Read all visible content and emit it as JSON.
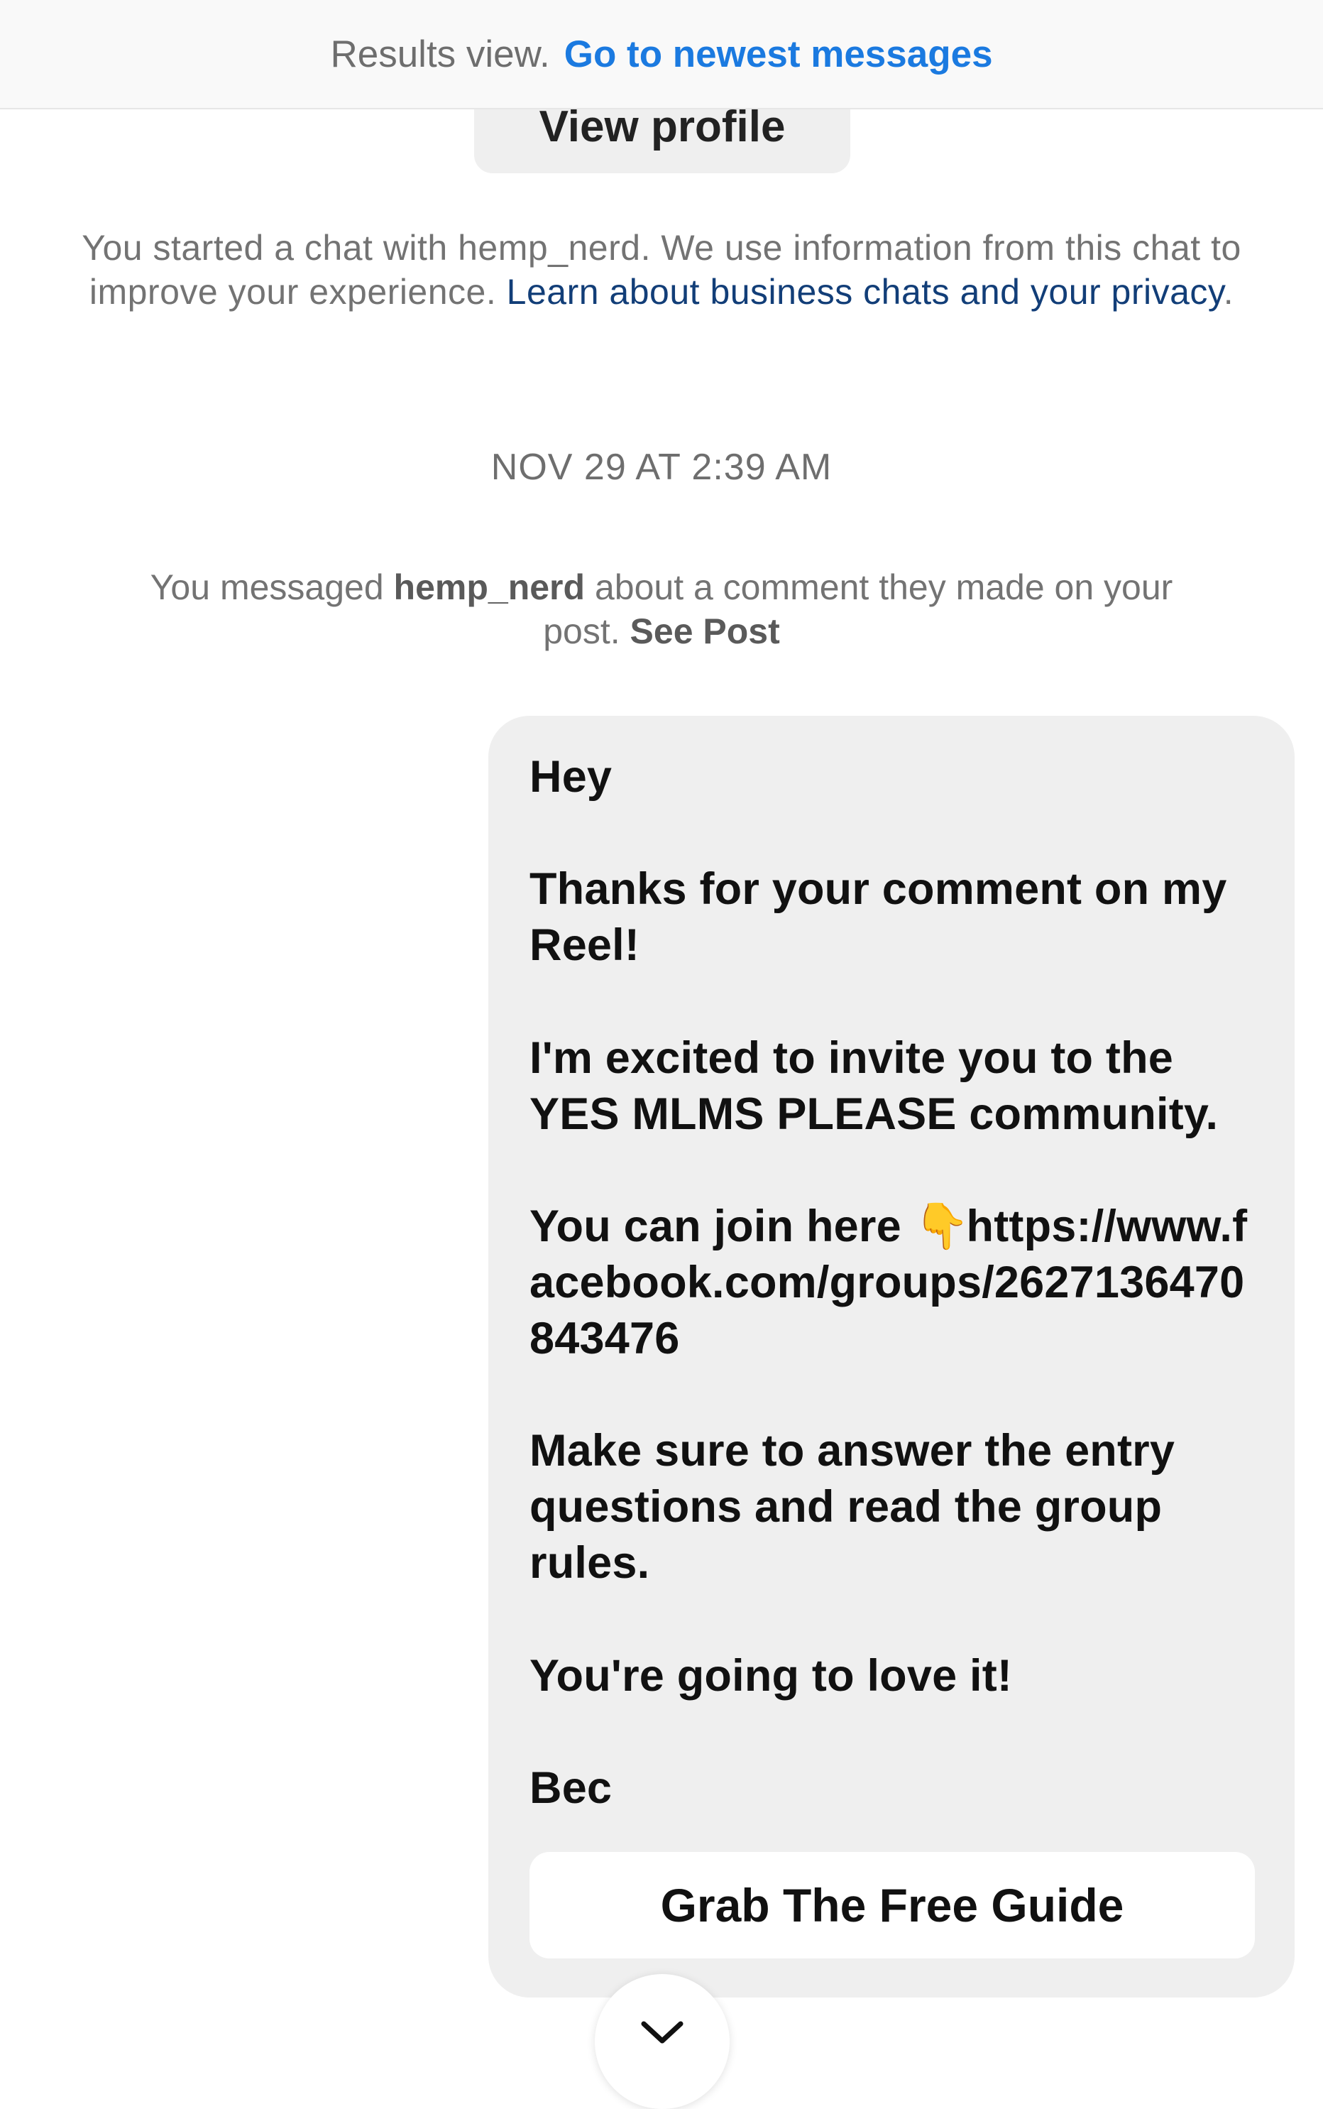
{
  "banner": {
    "label": "Results view.",
    "link": "Go to newest messages"
  },
  "profile": {
    "view_profile_label": "View profile"
  },
  "chat_notice": {
    "text": "You started a chat with hemp_nerd. We use information from this chat to improve your experience.",
    "link": "Learn about business chats and your privacy",
    "link_suffix": "."
  },
  "timestamp": "NOV 29 AT 2:39 AM",
  "context": {
    "prefix": "You messaged",
    "username": "hemp_nerd",
    "middle": "about a comment they made on your post.",
    "see_post": "See Post"
  },
  "message": {
    "greeting": "Hey",
    "thanks": "Thanks for your comment on my Reel!",
    "invite": "I'm excited to invite you to the YES MLMS PLEASE community.",
    "join_prefix": "You can join here",
    "join_emoji": "👇",
    "join_link": "https://www.facebook.com/groups/2627136470843476",
    "instructions": "Make sure to answer the entry questions and read the group rules.",
    "closing": "You're going to love it!",
    "signature": "Bec",
    "cta_label": "Grab The Free Guide"
  },
  "icons": {
    "scroll_down": "chevron-down-icon"
  }
}
